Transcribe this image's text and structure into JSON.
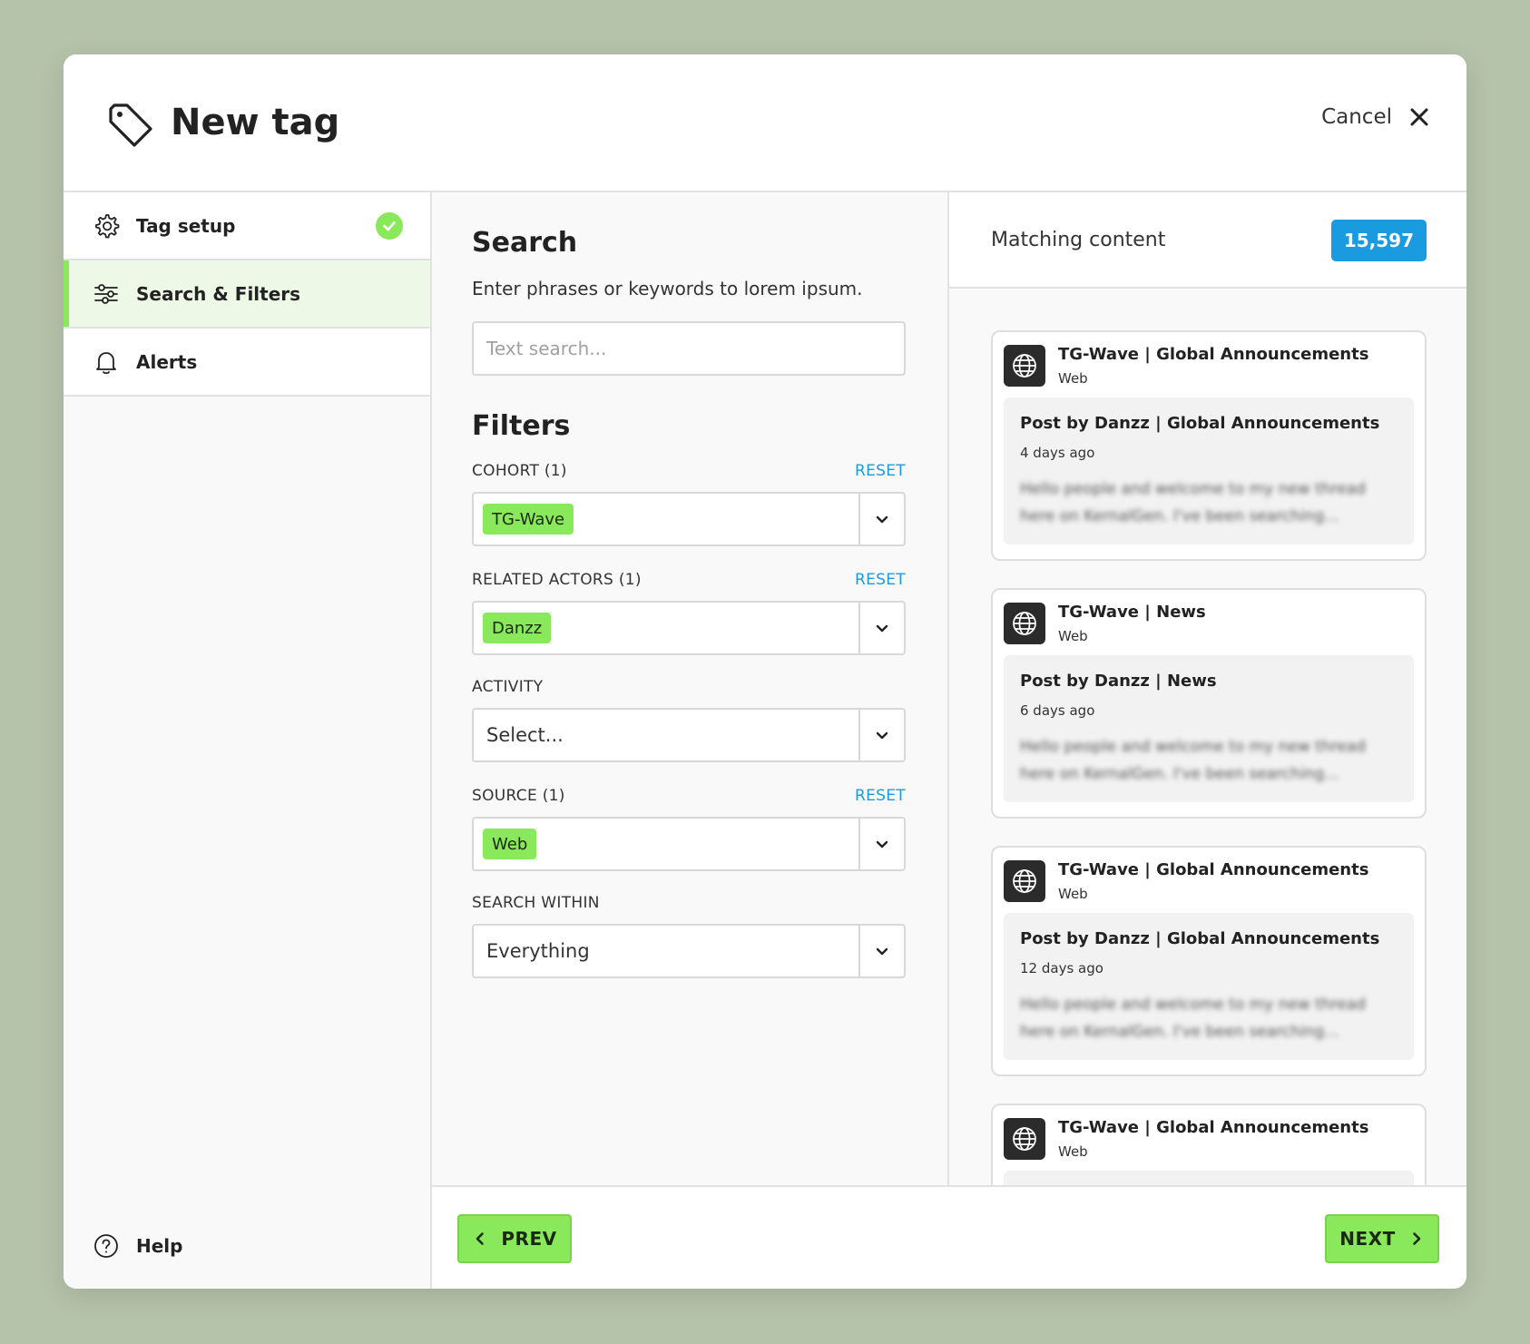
{
  "header": {
    "title": "New tag",
    "cancel_label": "Cancel"
  },
  "sidebar": {
    "items": [
      {
        "label": "Tag setup",
        "icon": "gear-icon",
        "completed": true
      },
      {
        "label": "Search & Filters",
        "icon": "sliders-icon",
        "active": true
      },
      {
        "label": "Alerts",
        "icon": "bell-icon"
      }
    ],
    "help_label": "Help"
  },
  "search": {
    "heading": "Search",
    "description": "Enter phrases or keywords to lorem ipsum.",
    "placeholder": "Text search..."
  },
  "filters": {
    "heading": "Filters",
    "reset_label": "RESET",
    "cohort": {
      "label": "COHORT (1)",
      "value": "TG-Wave"
    },
    "related_actors": {
      "label": "RELATED ACTORS (1)",
      "value": "Danzz"
    },
    "activity": {
      "label": "ACTIVITY",
      "placeholder": "Select..."
    },
    "source": {
      "label": "SOURCE (1)",
      "value": "Web"
    },
    "search_within": {
      "label": "SEARCH WITHIN",
      "value": "Everything"
    }
  },
  "matching": {
    "label": "Matching content",
    "count": "15,597",
    "cards": [
      {
        "title": "TG-Wave | Global Announcements",
        "source": "Web",
        "post_title": "Post by Danzz | Global Announcements",
        "time": "4 days ago",
        "body": "Hello people and welcome to my new thread here on KernalGen. I've been searching..."
      },
      {
        "title": "TG-Wave | News",
        "source": "Web",
        "post_title": "Post by Danzz | News",
        "time": "6 days ago",
        "body": "Hello people and welcome to my new thread here on KernalGen. I've been searching..."
      },
      {
        "title": "TG-Wave | Global Announcements",
        "source": "Web",
        "post_title": "Post by Danzz | Global Announcements",
        "time": "12 days ago",
        "body": "Hello people and welcome to my new thread here on KernalGen. I've been searching..."
      },
      {
        "title": "TG-Wave | Global Announcements",
        "source": "Web"
      }
    ]
  },
  "footer": {
    "prev_label": "PREV",
    "next_label": "NEXT"
  },
  "colors": {
    "accent_green": "#8ae85b",
    "badge_blue": "#1a9be0",
    "background": "#b6c3ab"
  }
}
